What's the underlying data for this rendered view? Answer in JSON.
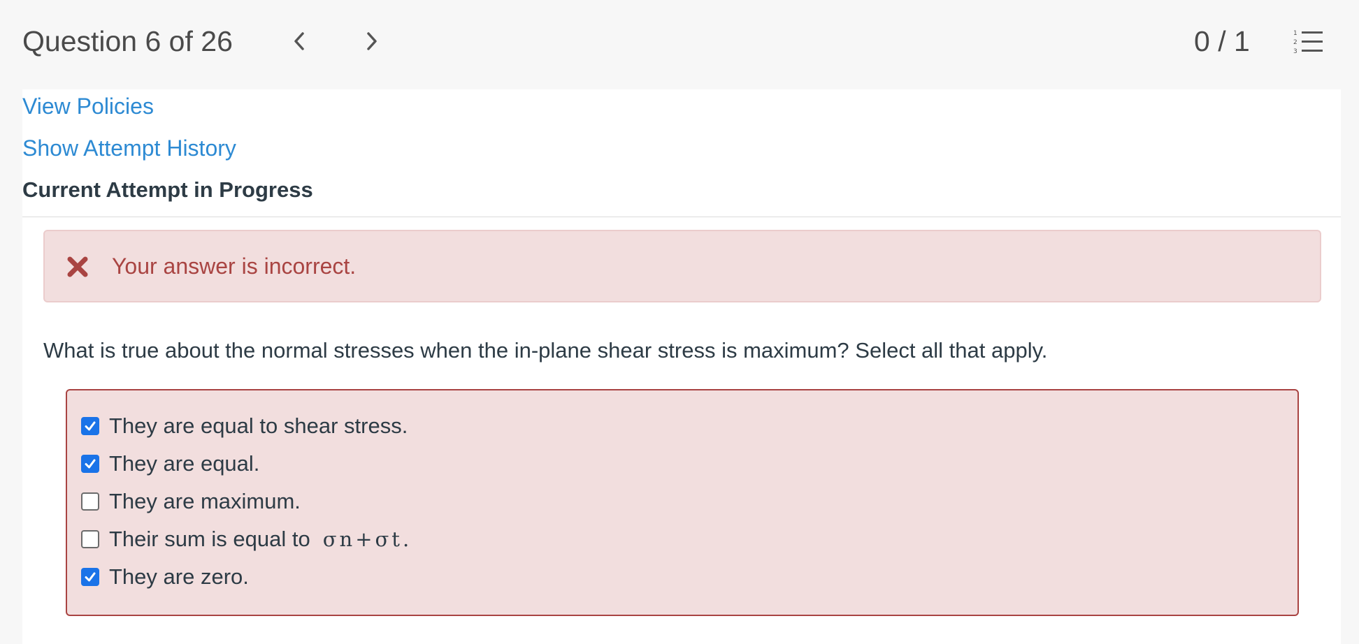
{
  "header": {
    "question_title": "Question 6 of 26",
    "score": "0 / 1"
  },
  "links": {
    "view_policies": "View Policies",
    "show_attempt_history": "Show Attempt History"
  },
  "attempt_status": "Current Attempt in Progress",
  "feedback": {
    "message": "Your answer is incorrect.",
    "color": "#a94442"
  },
  "question_text": "What is true about the normal stresses when the in-plane shear stress is maximum? Select all that apply.",
  "choices": [
    {
      "label": "They are equal to shear stress.",
      "checked": true
    },
    {
      "label": "They are equal.",
      "checked": true
    },
    {
      "label": "They are maximum.",
      "checked": false
    },
    {
      "label": "Their sum is equal to",
      "math": "σn+σt.",
      "checked": false
    },
    {
      "label": "They are zero.",
      "checked": true
    }
  ],
  "colors": {
    "link": "#2d8ad3",
    "checkbox_checked": "#1a73e8",
    "error_border": "#a94442",
    "error_background": "#f2dede"
  }
}
